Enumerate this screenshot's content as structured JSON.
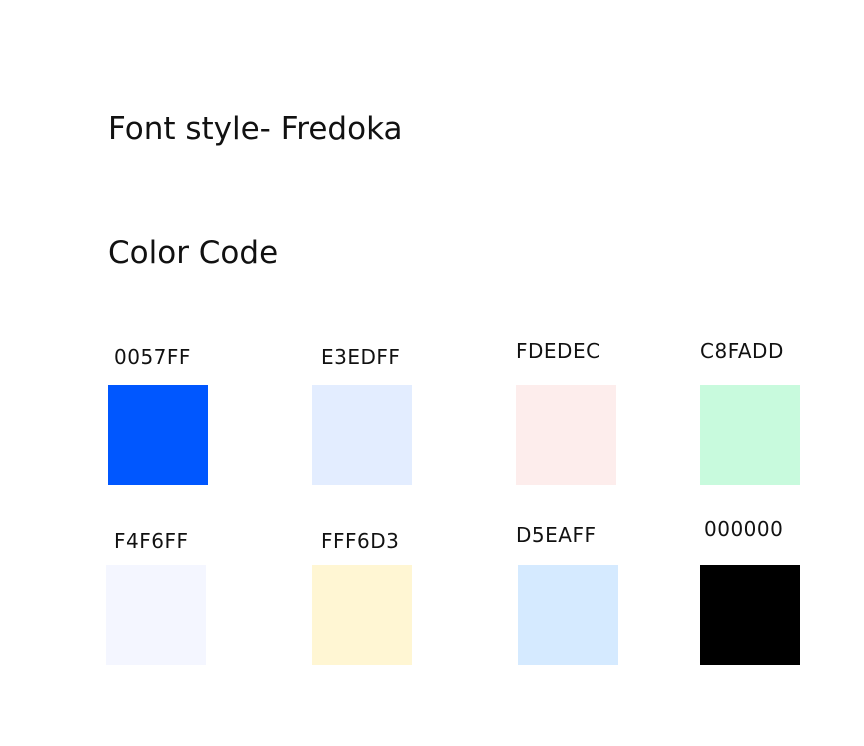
{
  "font_style": {
    "text": "Font style- Fredoka"
  },
  "color_code": {
    "text": "Color Code"
  },
  "swatches": [
    {
      "label": "0057FF",
      "color": "#0057FF"
    },
    {
      "label": "E3EDFF",
      "color": "#E3EDFF"
    },
    {
      "label": "FDEDEC",
      "color": "#FDEDEC"
    },
    {
      "label": "C8FADD",
      "color": "#C8FADD"
    },
    {
      "label": "F4F6FF",
      "color": "#F4F6FF"
    },
    {
      "label": "FFF6D3",
      "color": "#FFF6D3"
    },
    {
      "label": "D5EAFF",
      "color": "#D5EAFF"
    },
    {
      "label": "000000",
      "color": "#000000"
    }
  ]
}
